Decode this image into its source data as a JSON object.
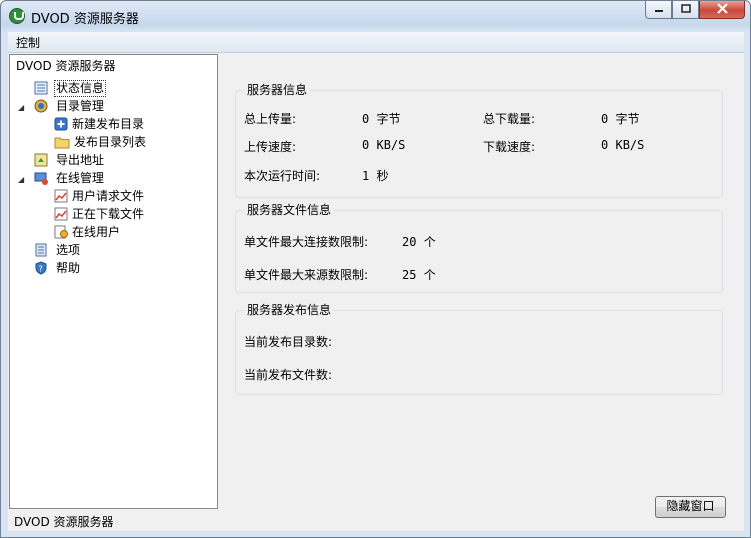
{
  "window": {
    "title": "DVOD 资源服务器",
    "controls": [
      "minimize-icon",
      "maximize-icon",
      "close-icon"
    ]
  },
  "menu": {
    "items": [
      "控制"
    ]
  },
  "tree": {
    "root": "DVOD 资源服务器",
    "items": [
      {
        "label": "状态信息",
        "icon": "status-icon",
        "selected": true
      },
      {
        "label": "目录管理",
        "icon": "directory-icon",
        "expanded": true
      },
      {
        "label": "新建发布目录",
        "icon": "add-icon"
      },
      {
        "label": "发布目录列表",
        "icon": "folder-icon"
      },
      {
        "label": "导出地址",
        "icon": "export-icon"
      },
      {
        "label": "在线管理",
        "icon": "online-icon",
        "expanded": true
      },
      {
        "label": "用户请求文件",
        "icon": "chart-icon"
      },
      {
        "label": "正在下载文件",
        "icon": "chart-icon"
      },
      {
        "label": "在线用户",
        "icon": "user-icon"
      },
      {
        "label": "选项",
        "icon": "options-icon"
      },
      {
        "label": "帮助",
        "icon": "help-icon"
      }
    ]
  },
  "server_info": {
    "title": "服务器信息",
    "upload_total_label": "总上传量:",
    "upload_total_value": "0",
    "upload_total_unit": "字节",
    "download_total_label": "总下载量:",
    "download_total_value": "0",
    "download_total_unit": "字节",
    "upload_speed_label": "上传速度:",
    "upload_speed_value": "0",
    "upload_speed_unit": "KB/S",
    "download_speed_label": "下载速度:",
    "download_speed_value": "0",
    "download_speed_unit": "KB/S",
    "uptime_label": "本次运行时间:",
    "uptime_value": "1",
    "uptime_unit": "秒"
  },
  "file_info": {
    "title": "服务器文件信息",
    "max_conn_label": "单文件最大连接数限制:",
    "max_conn_value": "20",
    "max_conn_unit": "个",
    "max_src_label": "单文件最大来源数限制:",
    "max_src_value": "25",
    "max_src_unit": "个"
  },
  "publish_info": {
    "title": "服务器发布信息",
    "dir_count_label": "当前发布目录数:",
    "file_count_label": "当前发布文件数:"
  },
  "status_bar": {
    "text": "DVOD 资源服务器"
  },
  "buttons": {
    "hide_window": "隐藏窗口"
  }
}
